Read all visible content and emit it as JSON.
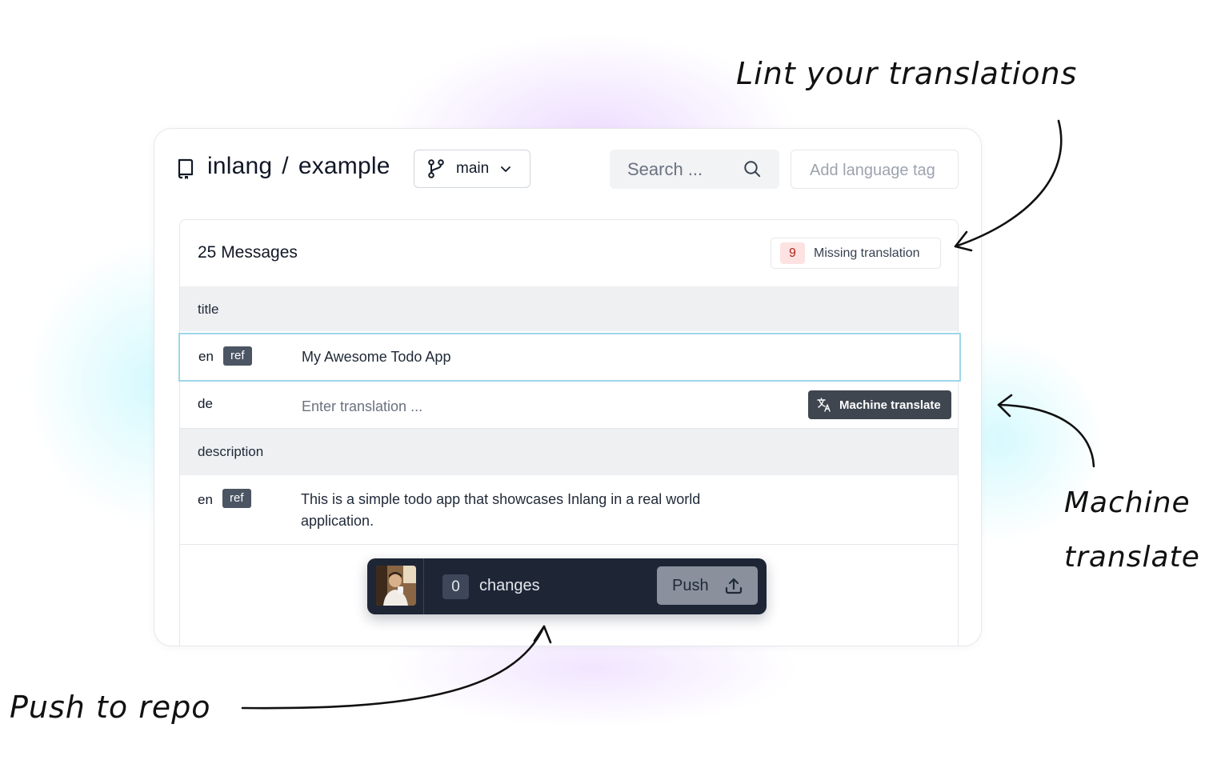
{
  "repo": {
    "owner": "inlang",
    "separator": "/",
    "name": "example"
  },
  "branch": {
    "label": "main"
  },
  "search": {
    "placeholder": "Search ..."
  },
  "add_language": {
    "placeholder": "Add language tag"
  },
  "messages": {
    "title": "25 Messages",
    "lint": {
      "count": "9",
      "label": "Missing translation"
    },
    "groups": [
      {
        "id": "title",
        "rows": [
          {
            "lang": "en",
            "badge": "ref",
            "text": "My Awesome Todo App"
          },
          {
            "lang": "de",
            "placeholder": "Enter translation ...",
            "action": "Machine translate"
          }
        ]
      },
      {
        "id": "description",
        "rows": [
          {
            "lang": "en",
            "badge": "ref",
            "text": "This is a simple todo app that showcases Inlang in a real world application."
          }
        ]
      }
    ]
  },
  "pushbar": {
    "count": "0",
    "label": "changes",
    "button": "Push"
  },
  "annotations": {
    "lint": "Lint your translations",
    "machine_line1": "Machine",
    "machine_line2": "translate",
    "push": "Push to repo"
  },
  "colors": {
    "selected_border": "#5aaed4",
    "lint_badge_bg": "#fde2e2",
    "lint_badge_text": "#b42318",
    "pushbar_bg": "#1e2636",
    "ref_badge_bg": "#4b5563"
  },
  "icons": [
    "repo-icon",
    "git-branch-icon",
    "chevron-down-icon",
    "search-icon",
    "translate-icon",
    "upload-icon"
  ]
}
